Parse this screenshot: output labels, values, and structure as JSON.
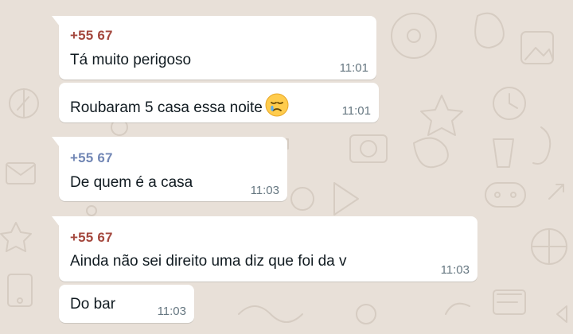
{
  "messages": [
    {
      "sender": "+55 67",
      "text": "Tá muito perigoso",
      "time": "11:01"
    },
    {
      "text": "Roubaram 5 casa essa noite",
      "emoji": "sad-face-emoji",
      "time": "11:01"
    },
    {
      "sender": "+55 67",
      "text": "De quem é a casa",
      "time": "11:03"
    },
    {
      "sender": "+55 67",
      "text": "Ainda não sei direito uma diz que foi da v",
      "time": "11:03"
    },
    {
      "text": "Do bar",
      "time": "11:03"
    }
  ],
  "colors": {
    "sender_red": "#a4483e",
    "sender_blue": "#7287b5",
    "wallpaper": "#e8e0d8",
    "time": "#667781"
  }
}
